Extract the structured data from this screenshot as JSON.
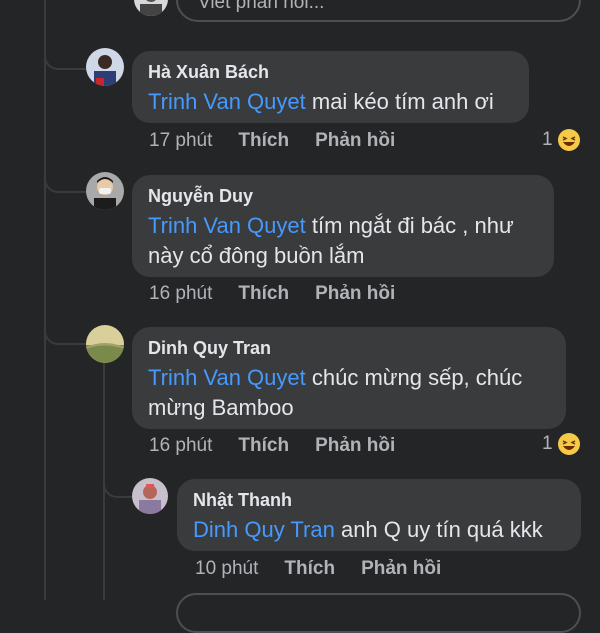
{
  "reply_input": {
    "placeholder": "Viết phản hồi..."
  },
  "comments": [
    {
      "author": "Hà Xuân Bách",
      "mention": "Trinh Van Quyet",
      "text": " mai kéo tím anh ơi",
      "time": "17 phút",
      "like_label": "Thích",
      "reply_label": "Phản hồi",
      "reaction_count": "1"
    },
    {
      "author": "Nguyễn Duy",
      "mention": "Trinh Van Quyet",
      "text": " tím ngắt đi bác , như này cổ đông buồn lắm",
      "time": "16 phút",
      "like_label": "Thích",
      "reply_label": "Phản hồi"
    },
    {
      "author": "Dinh Quy Tran",
      "mention": "Trinh Van Quyet",
      "text": " chúc mừng sếp, chúc mừng Bamboo",
      "time": "16 phút",
      "like_label": "Thích",
      "reply_label": "Phản hồi",
      "reaction_count": "1"
    },
    {
      "author": "Nhật Thanh",
      "mention": "Dinh Quy Tran",
      "text": " anh Q uy tín quá kkk",
      "time": "10 phút",
      "like_label": "Thích",
      "reply_label": "Phản hồi"
    }
  ],
  "colors": {
    "background": "#242526",
    "bubble": "#3a3b3c",
    "mention": "#4599ff",
    "meta": "#b0b3b8"
  },
  "icons": [
    "avatar",
    "laughing-emoji-icon"
  ]
}
